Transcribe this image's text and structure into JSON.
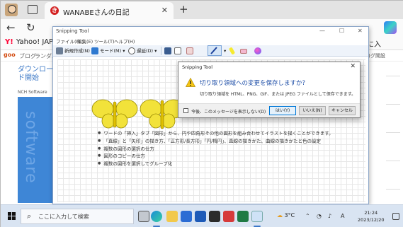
{
  "browser": {
    "tab_title": "WANABEさんの日記",
    "tab_favicon": "き",
    "new_tab": "+",
    "favorites_yahoo_logo": "Y!",
    "favorites_yahoo": "Yahoo! JAPAN",
    "favorites_right": "に入",
    "sub_logo": "goo",
    "sub_items": [
      "ブログ",
      "ランダム"
    ],
    "sub_right": "ログ開設"
  },
  "page": {
    "download_title": "ダウンロード開始",
    "nch_label": "NCH Software",
    "side_text": "software"
  },
  "snipping_tool": {
    "title": "Snipping Tool",
    "menus": [
      "ファイル(F)",
      "編集(E)",
      "ツール(T)",
      "ヘルプ(H)"
    ],
    "toolbar": {
      "new": "新規作成(N)",
      "mode": "モード(M)",
      "delay": "遅延(D)"
    },
    "bullets": [
      "ワードの「挿入」タブ「図形」から、円や四角形その他の図形を組み合わせてイラストを描くことができます。",
      "「直線」と「矢印」の描き方、「正方形/長方形」「円/楕円」、直線の描きかた、曲線の描きかたと色の設定",
      "複数の図形の選択の仕方",
      "図形のコピーの仕方",
      "複数の図形を選択してグループ化"
    ]
  },
  "dialog": {
    "title": "Snipping Tool",
    "heading": "切り取り領域への変更を保存しますか?",
    "message": "切り取り領域を HTML、PNG、GIF、または JPEG ファイルとして保存できます。",
    "checkbox_label": "今後、このメッセージを表示しない(D)",
    "yes": "はい(Y)",
    "no": "いいえ(N)",
    "cancel": "キャンセル"
  },
  "taskbar": {
    "search_placeholder": "ここに入力して検索",
    "weather": "3°C",
    "time": "21:24",
    "date": "2023/12/20"
  },
  "colors": {
    "accent": "#0078d7",
    "heading_blue": "#1f4fa8",
    "butterfly_yellow": "#f2e23a"
  }
}
